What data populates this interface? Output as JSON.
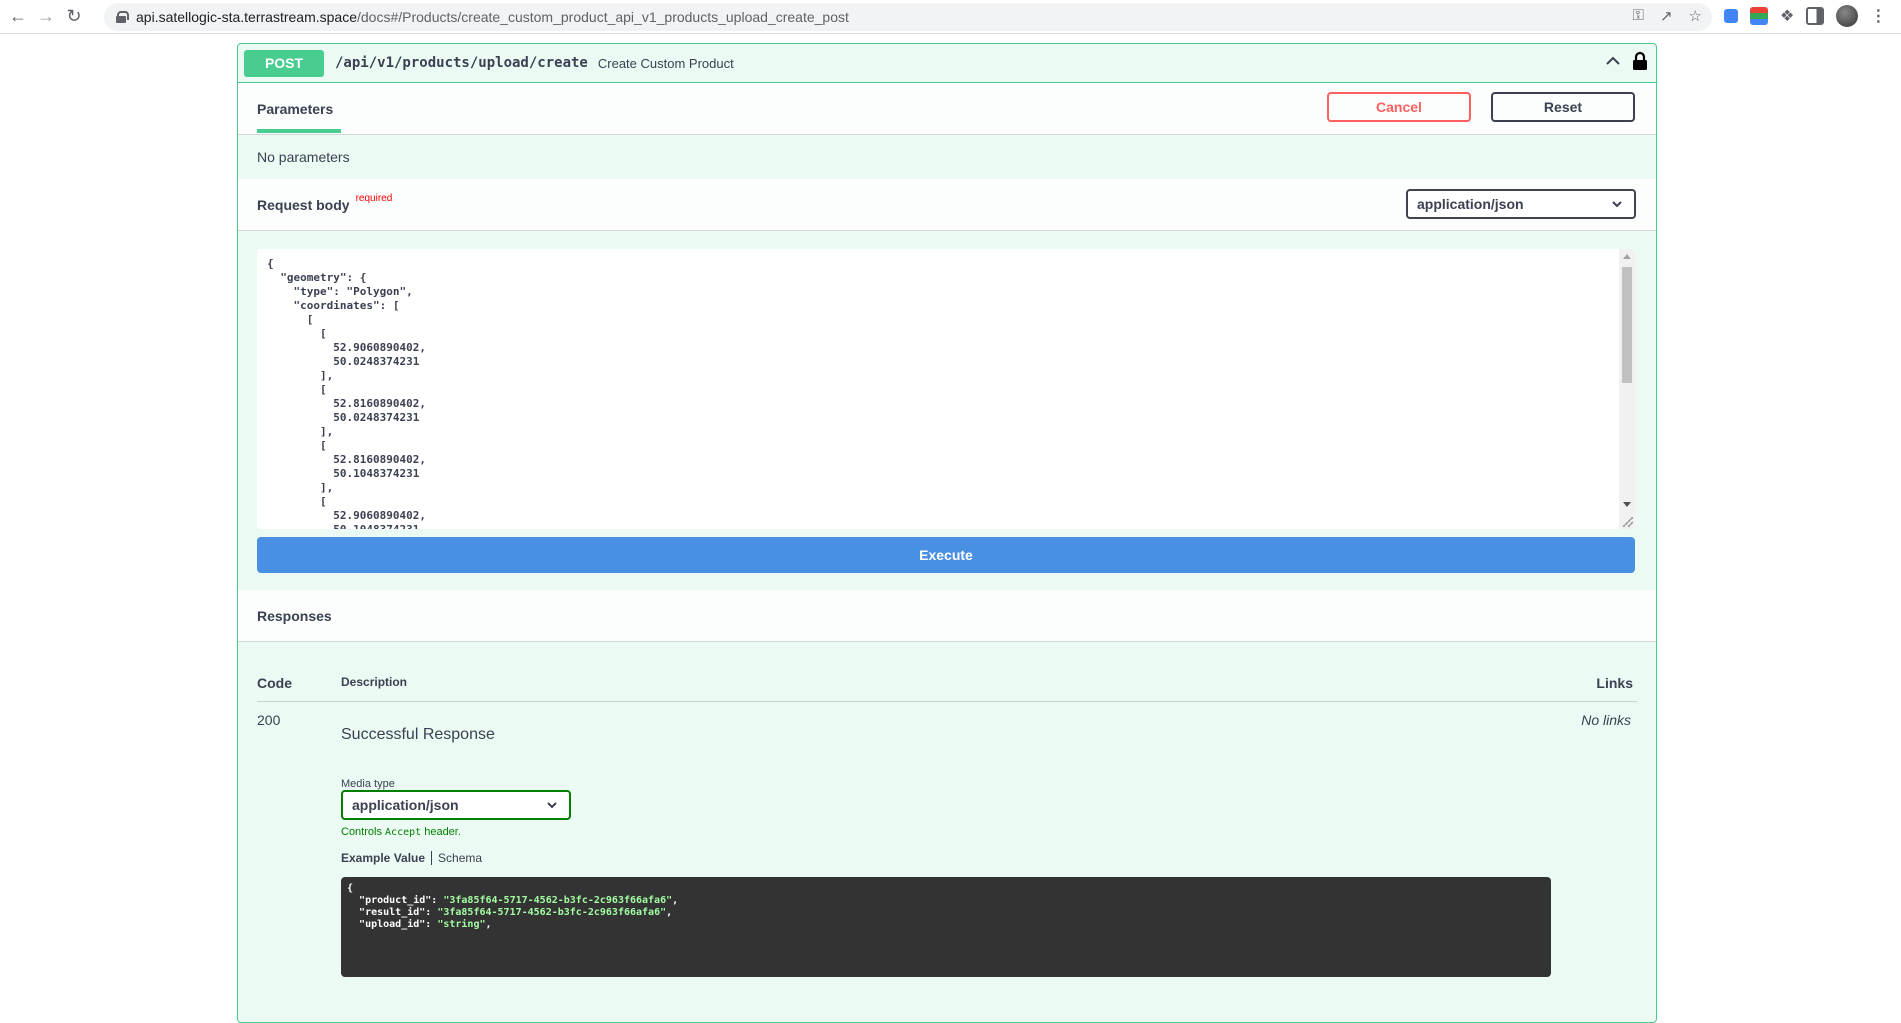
{
  "browser": {
    "url_host": "api.satellogic-sta.terrastream.space",
    "url_path": "/docs#/Products/create_custom_product_api_v1_products_upload_create_post"
  },
  "operation": {
    "method": "POST",
    "path": "/api/v1/products/upload/create",
    "summary": "Create Custom Product"
  },
  "tabs": {
    "parameters": "Parameters",
    "cancel": "Cancel",
    "reset": "Reset"
  },
  "parameters": {
    "none_text": "No parameters"
  },
  "request_body": {
    "title": "Request body",
    "required": "required",
    "content_type": "application/json",
    "code": "{\n  \"geometry\": {\n    \"type\": \"Polygon\",\n    \"coordinates\": [\n      [\n        [\n          52.9060890402,\n          50.0248374231\n        ],\n        [\n          52.8160890402,\n          50.0248374231\n        ],\n        [\n          52.8160890402,\n          50.1048374231\n        ],\n        [\n          52.9060890402,\n          50.1048374231"
  },
  "execute": "Execute",
  "responses": {
    "title": "Responses",
    "col_code": "Code",
    "col_description": "Description",
    "col_links": "Links",
    "rows": [
      {
        "code": "200",
        "description": "Successful Response",
        "links": "No links",
        "media_type_label": "Media type",
        "media_type": "application/json",
        "controls_prefix": "Controls ",
        "controls_code": "Accept",
        "controls_suffix": " header.",
        "example_tab": "Example Value",
        "schema_tab": "Schema",
        "example_lines": [
          {
            "key": "\"product_id\"",
            "value": "\"3fa85f64-5717-4562-b3fc-2c963f66afa6\""
          },
          {
            "key": "\"result_id\"",
            "value": "\"3fa85f64-5717-4562-b3fc-2c963f66afa6\""
          },
          {
            "key": "\"upload_id\"",
            "value": "\"string\""
          }
        ]
      }
    ]
  },
  "colors": {
    "post": "#49cc90",
    "cancel": "#ff6060",
    "execute": "#4990e2",
    "media_border": "#008000"
  }
}
